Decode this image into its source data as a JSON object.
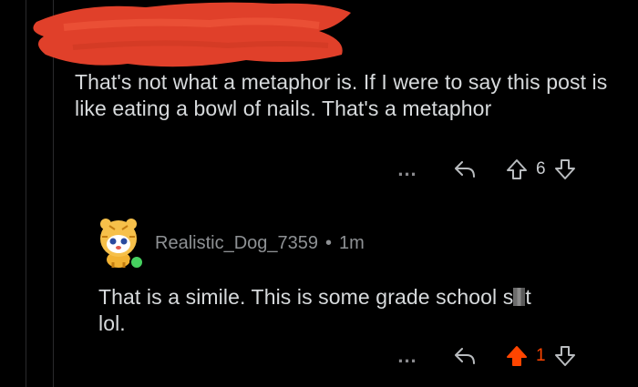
{
  "parent_comment": {
    "body": "That's not what a metaphor is. If I were to say this post is like eating a bowl of nails. That's a metaphor",
    "score": "6"
  },
  "reply": {
    "username": "Realistic_Dog_7359",
    "separator": "•",
    "time": "1m",
    "body_before": "That is a simile. This is some grade school s",
    "body_after": "t",
    "body_line2": "lol.",
    "score": "1"
  },
  "actions": {
    "more_label": "...",
    "icons": [
      "reply-icon",
      "upvote-icon",
      "downvote-icon",
      "more-icon"
    ]
  },
  "colors": {
    "background": "#000000",
    "text": "#d7dadc",
    "muted": "#8e9194",
    "upvoted": "#ff4500",
    "redaction": "#e0402a",
    "online": "#46d160"
  }
}
